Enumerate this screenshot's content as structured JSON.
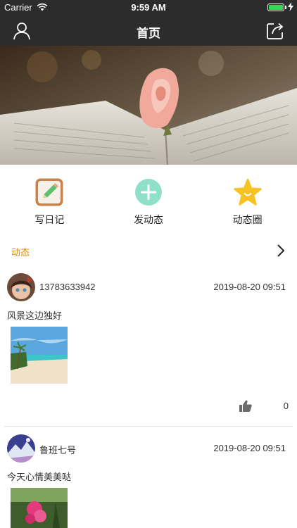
{
  "status_bar": {
    "carrier": "Carrier",
    "time": "9:59 AM",
    "battery_level": 1.0
  },
  "nav": {
    "title": "首页",
    "left_icon": "user-icon",
    "right_icon": "share-icon"
  },
  "banner": {
    "image": "open-book-with-rose"
  },
  "actions": [
    {
      "label": "写日记",
      "icon": "diary-icon",
      "color": "#c9834a"
    },
    {
      "label": "发动态",
      "icon": "plus-circle-icon",
      "color": "#8fe0c8"
    },
    {
      "label": "动态圈",
      "icon": "star-icon",
      "color": "#f7c322"
    }
  ],
  "section": {
    "title": "动态",
    "accent": "#e58a00"
  },
  "posts": [
    {
      "username": "13783633942",
      "time": "2019-08-20 09:51",
      "text": "风景这边独好",
      "image": "beach-photo",
      "likes": "0"
    },
    {
      "username": "鲁班七号",
      "time": "2019-08-20 09:51",
      "text": "今天心情美美哒",
      "image": "flower-photo"
    }
  ]
}
